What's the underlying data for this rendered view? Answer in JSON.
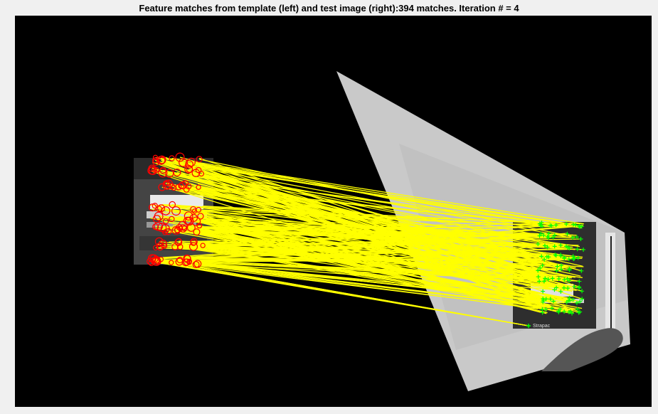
{
  "figure": {
    "title": "Feature matches from template (left) and test image (right):394 matches.  Iteration # = 4"
  },
  "visualization": {
    "description_label": "feature-match-visualization",
    "match_count": 394,
    "iteration": 4,
    "template_marker_color": "#ff0000",
    "test_marker_color": "#00ff00",
    "match_line_color": "#ffff00",
    "background_color": "#000000",
    "warped_image_color": "#c8c8c8",
    "test_image_text": "Strapac"
  }
}
